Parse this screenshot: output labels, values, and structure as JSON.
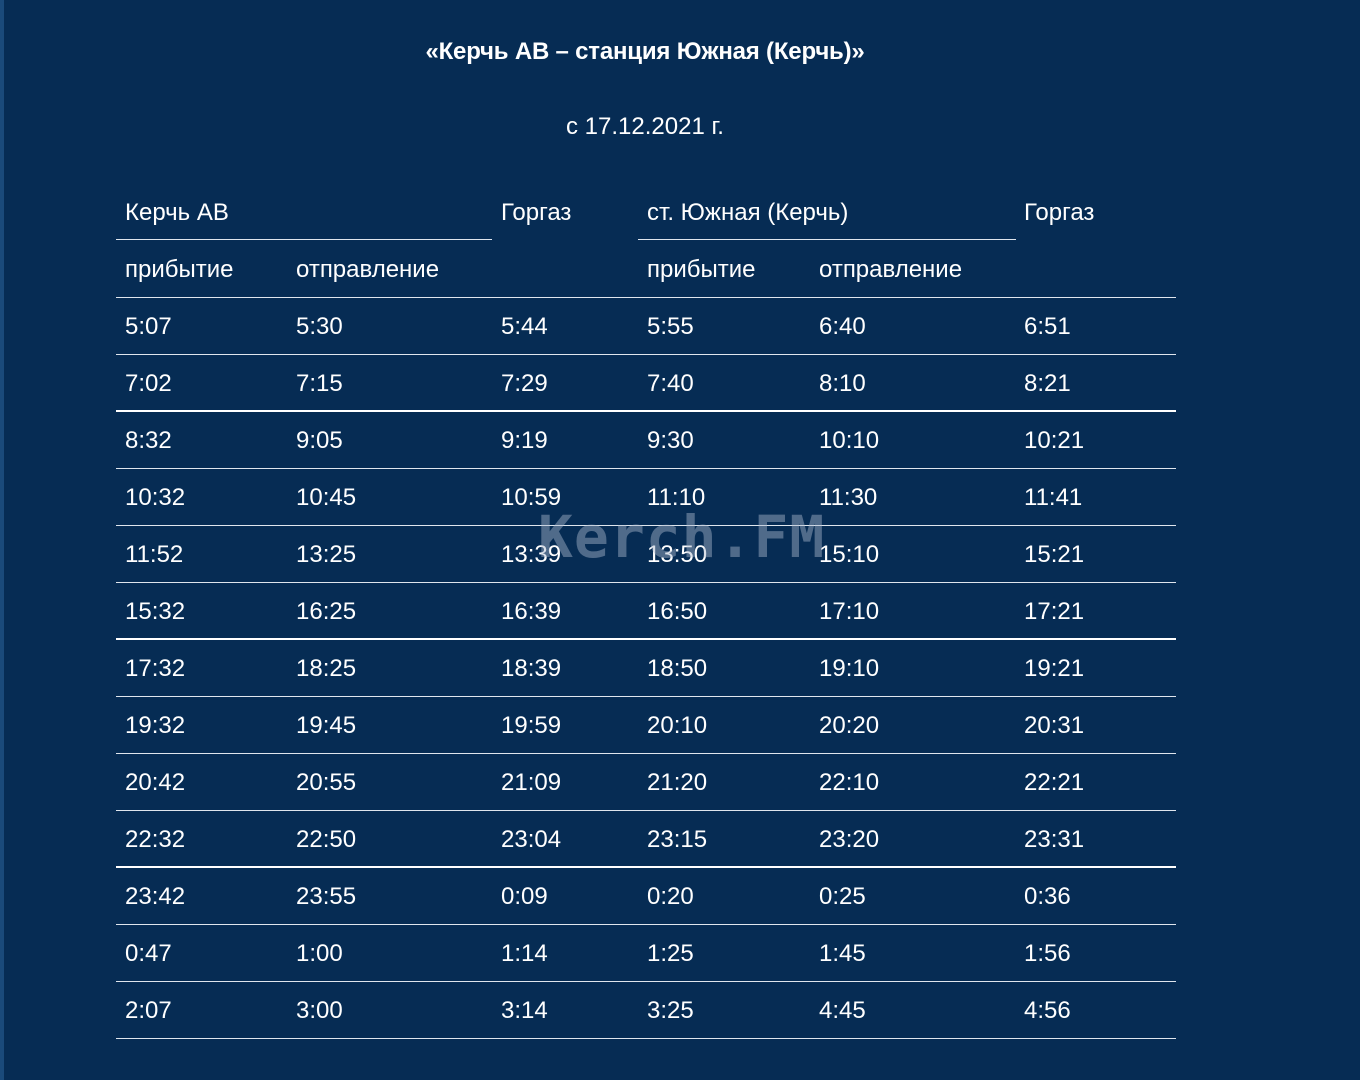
{
  "title": "«Керчь АВ – станция Южная (Керчь)»",
  "subtitle": "с 17.12.2021 г.",
  "table": {
    "group_headers": {
      "kerch_av": "Керчь АВ",
      "gorgaz_1": "Горгаз",
      "yuzhnaya": "ст. Южная (Керчь)",
      "gorgaz_2": "Горгаз"
    },
    "sub_headers": [
      "прибытие",
      "отправление",
      "",
      "прибытие",
      "отправление",
      ""
    ],
    "rows": [
      [
        "5:07",
        "5:30",
        "5:44",
        "5:55",
        "6:40",
        "6:51"
      ],
      [
        "7:02",
        "7:15",
        "7:29",
        "7:40",
        "8:10",
        "8:21"
      ],
      [
        "8:32",
        "9:05",
        "9:19",
        "9:30",
        "10:10",
        "10:21"
      ],
      [
        "10:32",
        "10:45",
        "10:59",
        "11:10",
        "11:30",
        "11:41"
      ],
      [
        "11:52",
        "13:25",
        "13:39",
        "13:50",
        "15:10",
        "15:21"
      ],
      [
        "15:32",
        "16:25",
        "16:39",
        "16:50",
        "17:10",
        "17:21"
      ],
      [
        "17:32",
        "18:25",
        "18:39",
        "18:50",
        "19:10",
        "19:21"
      ],
      [
        "19:32",
        "19:45",
        "19:59",
        "20:10",
        "20:20",
        "20:31"
      ],
      [
        "20:42",
        "20:55",
        "21:09",
        "21:20",
        "22:10",
        "22:21"
      ],
      [
        "22:32",
        "22:50",
        "23:04",
        "23:15",
        "23:20",
        "23:31"
      ],
      [
        "23:42",
        "23:55",
        "0:09",
        "0:20",
        "0:25",
        "0:36"
      ],
      [
        "0:47",
        "1:00",
        "1:14",
        "1:25",
        "1:45",
        "1:56"
      ],
      [
        "2:07",
        "3:00",
        "3:14",
        "3:25",
        "4:45",
        "4:56"
      ]
    ]
  },
  "watermark": "Kerch.FM",
  "colors": {
    "background": "#062c54",
    "text": "#ffffff",
    "rule": "#dfe6ee"
  }
}
